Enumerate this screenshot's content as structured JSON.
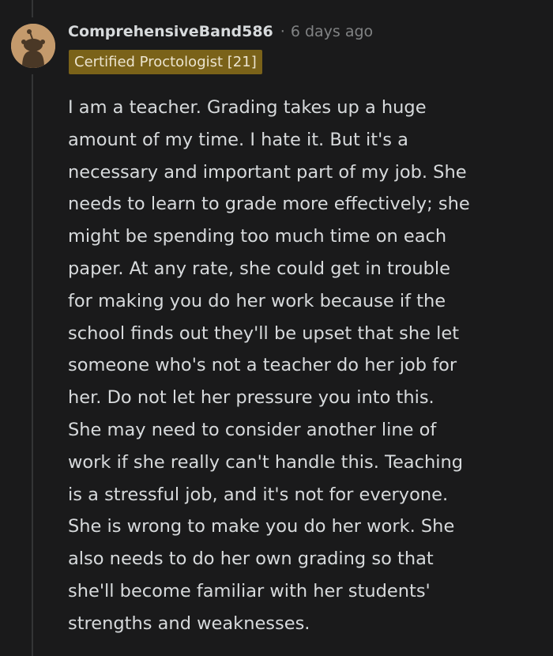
{
  "comment": {
    "author": "ComprehensiveBand586",
    "separator": "·",
    "timestamp": "6 days ago",
    "flair": "Certified Proctologist [21]",
    "body_lines": [
      "I am a teacher. Grading takes up a huge",
      "amount of my time. I hate it. But it's a",
      "necessary and important part of my job. She",
      "needs to learn to grade more effectively; she",
      "might be spending too much time on each",
      "paper. At any rate, she could get in trouble",
      "for making you do her work because if the",
      "school finds out they'll be upset that she let",
      "someone who's not a teacher do her job for",
      "her. Do not let her pressure you into this.",
      "She may need to consider another line of",
      "work if she really can't handle this. Teaching",
      "is a stressful job, and it's not for everyone.",
      "She is wrong to make you do her work. She",
      "also needs to do her own grading so that",
      "she'll become familiar with her students'",
      "strengths and weaknesses."
    ]
  },
  "colors": {
    "background": "#1a1a1b",
    "text": "#d7dadc",
    "muted": "#818384",
    "flair_bg": "#7a6219",
    "avatar_bg": "#c49a6c",
    "thread_line": "#343536"
  },
  "icons": {
    "avatar": "reddit-snoo-avatar-icon"
  }
}
